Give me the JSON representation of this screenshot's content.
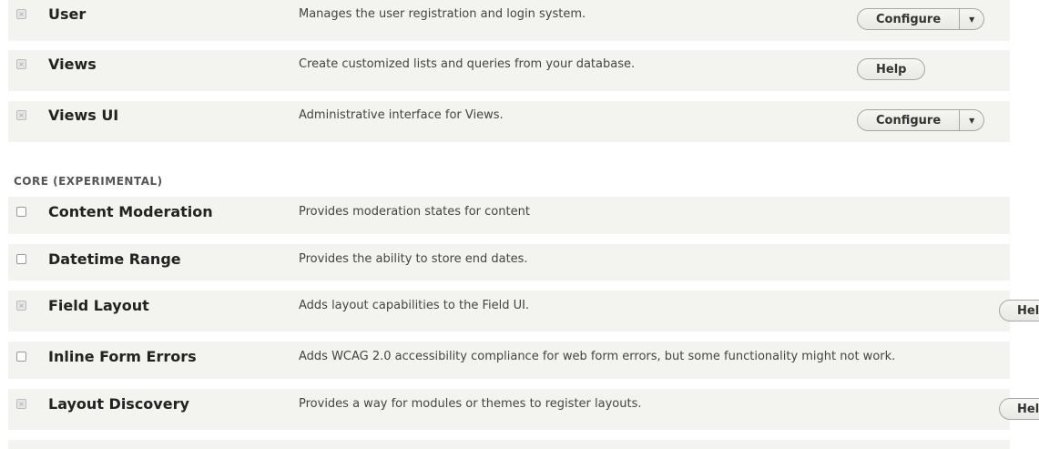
{
  "stable": [
    {
      "name": "User",
      "desc": "Manages the user registration and login system.",
      "enabled": true,
      "button": "Configure",
      "dropdown": true
    },
    {
      "name": "Views",
      "desc": "Create customized lists and queries from your database.",
      "enabled": true,
      "button": "Help",
      "dropdown": false
    },
    {
      "name": "Views UI",
      "desc": "Administrative interface for Views.",
      "enabled": true,
      "button": "Configure",
      "dropdown": true
    }
  ],
  "experimental_header": "CORE (EXPERIMENTAL)",
  "experimental": [
    {
      "name": "Content Moderation",
      "desc": "Provides moderation states for content",
      "enabled": false,
      "button": null
    },
    {
      "name": "Datetime Range",
      "desc": "Provides the ability to store end dates.",
      "enabled": false,
      "button": null
    },
    {
      "name": "Field Layout",
      "desc": "Adds layout capabilities to the Field UI.",
      "enabled": true,
      "button": "Hel"
    },
    {
      "name": "Inline Form Errors",
      "desc": "Adds WCAG 2.0 accessibility compliance for web form errors, but some functionality might not work.",
      "enabled": false,
      "button": null
    },
    {
      "name": "Layout Discovery",
      "desc": "Provides a way for modules or themes to register layouts.",
      "enabled": true,
      "button": "Hel"
    }
  ]
}
